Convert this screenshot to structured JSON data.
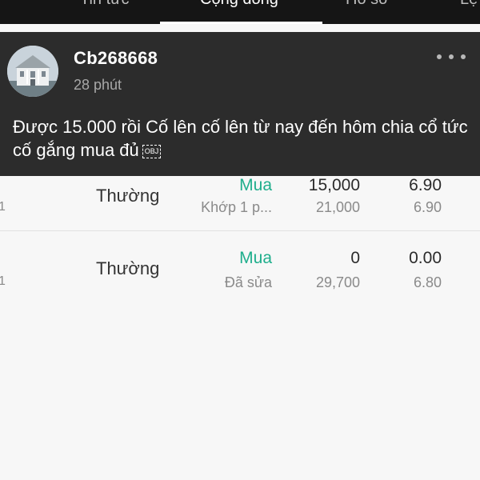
{
  "tabs": [
    "Tin tức",
    "Cộng đồng",
    "Hồ sơ",
    "Lệ"
  ],
  "post": {
    "username": "Cb268668",
    "time": "28 phút",
    "content": "Được 15.000 rồi Cố lên cố lên từ nay đến hôm chia cổ tức cố gắng mua đủ",
    "object_marker": "OBJ"
  },
  "orders": [
    {
      "edge": "1",
      "type": "Thường",
      "side": "Mua",
      "status": "Khớp 1 p...",
      "quantity": "15,000",
      "matched_quantity": "21,000",
      "price": "6.90",
      "matched_price": "6.90"
    },
    {
      "edge": "1",
      "type": "Thường",
      "side": "Mua",
      "status": "Đã sửa",
      "quantity": "0",
      "matched_quantity": "29,700",
      "price": "0.00",
      "matched_price": "6.80"
    }
  ],
  "colors": {
    "buy_side": "#1fae8c",
    "card_background": "#2c2c2c",
    "tab_bar": "#151515"
  }
}
